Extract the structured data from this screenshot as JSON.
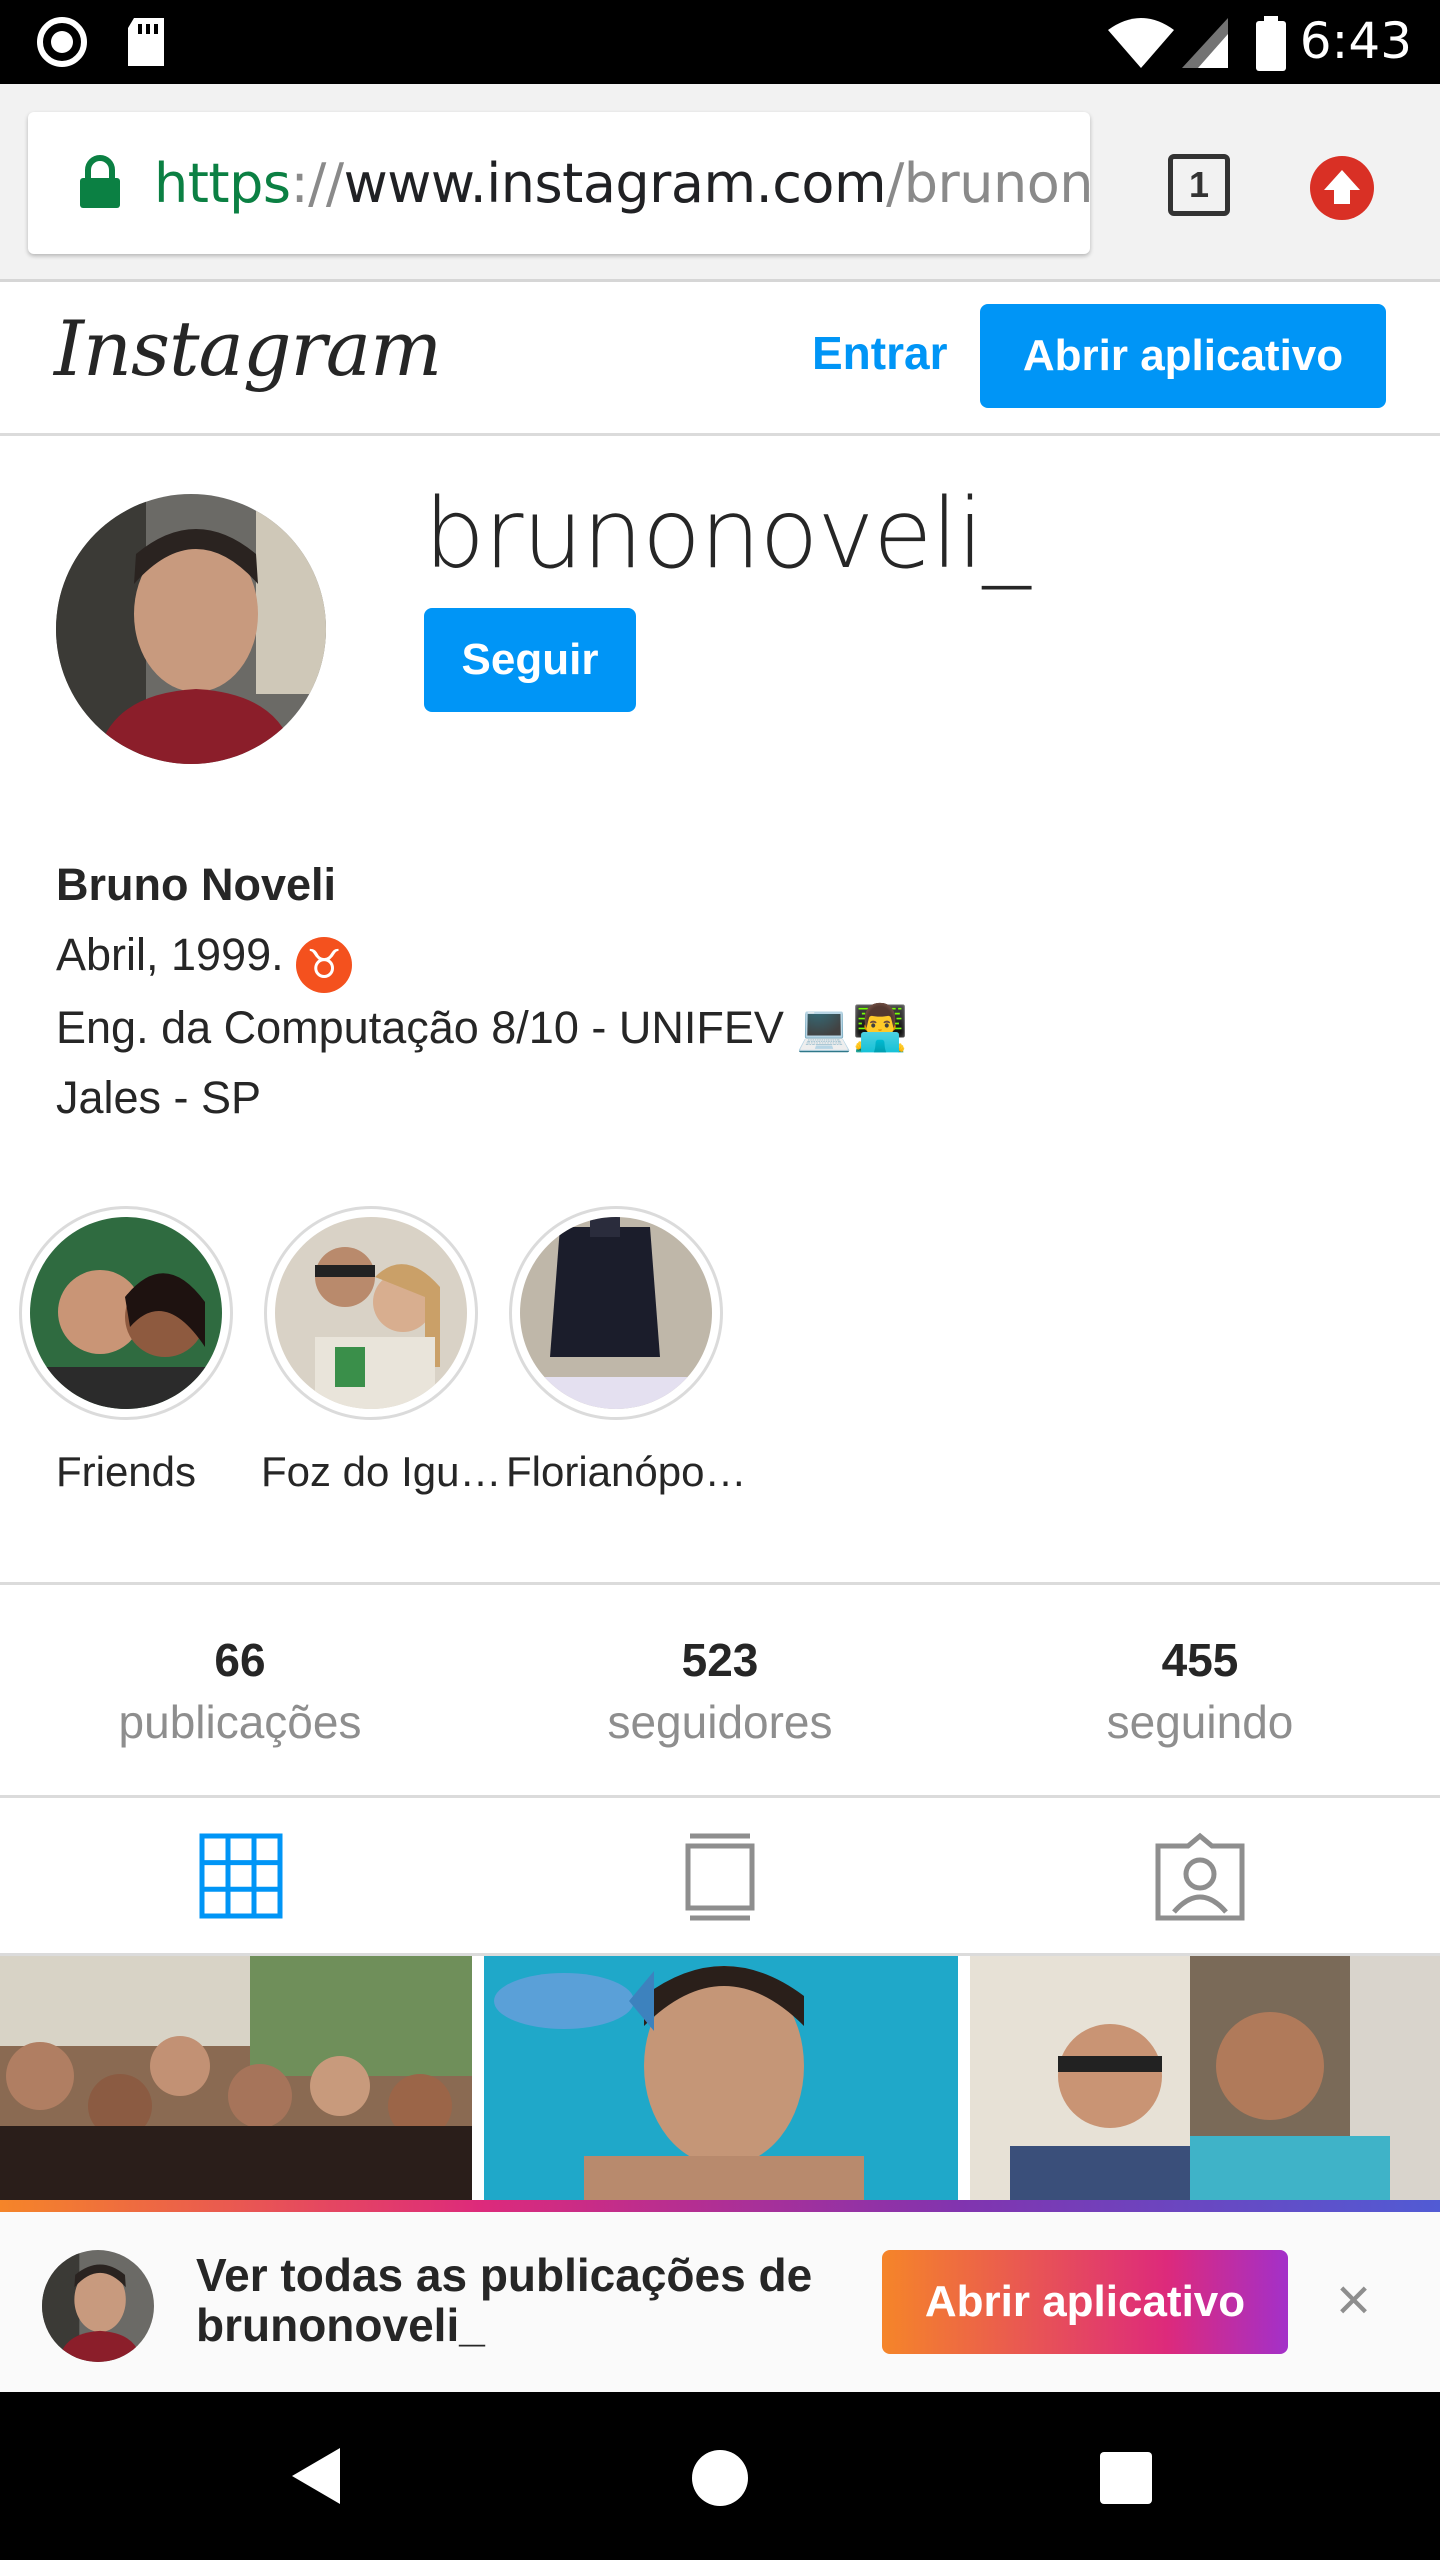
{
  "status_bar": {
    "time": "6:43"
  },
  "browser": {
    "url_scheme": "https",
    "url_sep": "://",
    "url_host": "www.instagram.com",
    "url_path": "/brunonoveli_/",
    "tab_count": "1"
  },
  "header": {
    "logo_text": "Instagram",
    "login_label": "Entrar",
    "open_app_label": "Abrir aplicativo"
  },
  "profile": {
    "username": "brunonoveli_",
    "follow_label": "Seguir",
    "full_name": "Bruno Noveli",
    "bio_line1": "Abril, 1999.",
    "bio_line2": "Eng. da Computação 8/10 - UNIFEV 💻👨‍💻",
    "bio_line3": "Jales - SP"
  },
  "highlights": [
    {
      "label": "Friends"
    },
    {
      "label": "Foz do Igu…"
    },
    {
      "label": "Florianópo…"
    }
  ],
  "stats": {
    "posts": {
      "count": "66",
      "label": "publicações"
    },
    "followers": {
      "count": "523",
      "label": "seguidores"
    },
    "following": {
      "count": "455",
      "label": "seguindo"
    }
  },
  "banner": {
    "text": "Ver todas as publicações de brunonoveli_",
    "open_app_label": "Abrir aplicativo",
    "close_glyph": "×"
  },
  "colors": {
    "accent": "#0095f6",
    "chrome_green": "#0b8043"
  }
}
